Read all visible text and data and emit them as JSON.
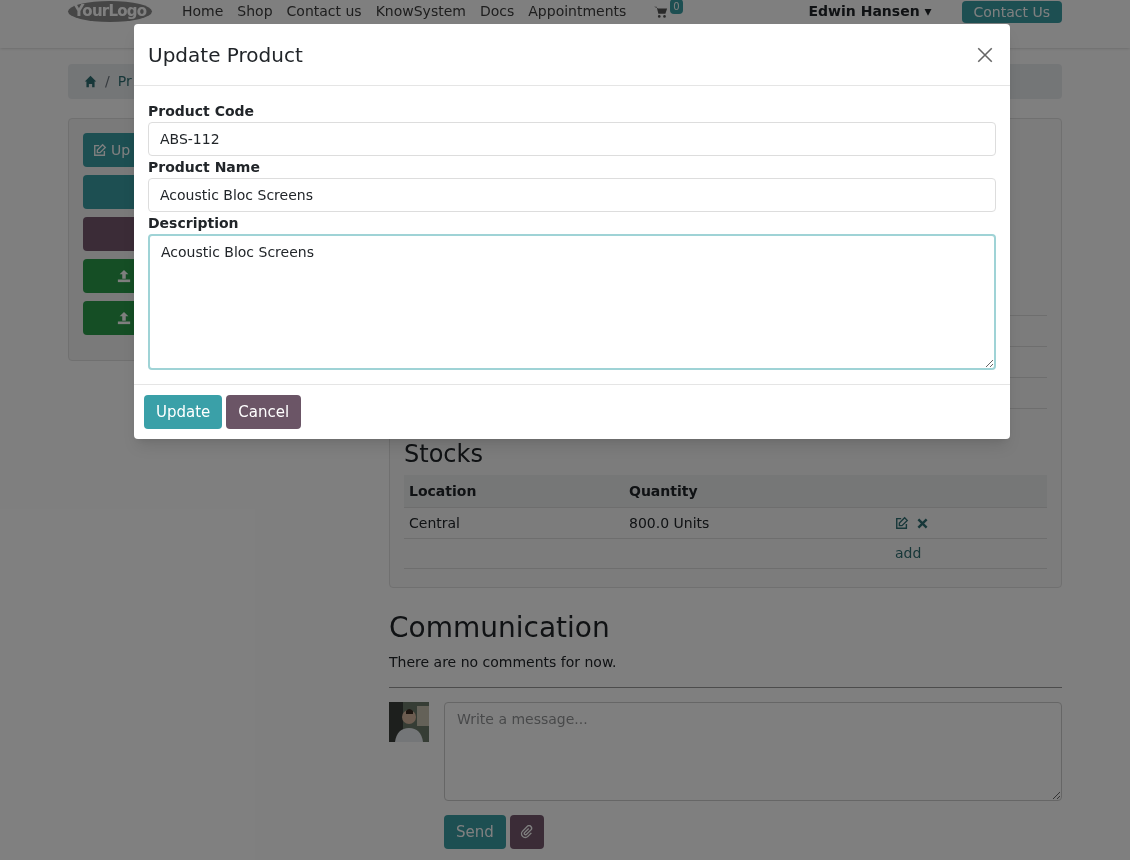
{
  "navbar": {
    "logo": "YourLogo",
    "menu": [
      "Home",
      "Shop",
      "Contact us",
      "KnowSystem",
      "Docs",
      "Appointments"
    ],
    "cart_count": "0",
    "user": "Edwin Hansen",
    "user_caret": "▾",
    "cta": "Contact Us"
  },
  "breadcrumb": {
    "separator": "/",
    "item": "Pr"
  },
  "sidebar": {
    "buttons": [
      {
        "kind": "edit",
        "label": "Up"
      },
      {
        "kind": "primary"
      },
      {
        "kind": "secondary"
      },
      {
        "kind": "upload"
      },
      {
        "kind": "upload"
      }
    ]
  },
  "stocks": {
    "title": "Stocks",
    "columns": [
      "Location",
      "Quantity"
    ],
    "rows": [
      {
        "location": "Central",
        "quantity": "800.0 Units"
      }
    ],
    "add_link": "add"
  },
  "communication": {
    "title": "Communication",
    "empty_text": "There are no comments for now.",
    "message_placeholder": "Write a message...",
    "send": "Send"
  },
  "modal": {
    "title": "Update Product",
    "fields": [
      {
        "kind": "input",
        "label": "Product Code",
        "value": "ABS-112"
      },
      {
        "kind": "input",
        "label": "Product Name",
        "value": "Acoustic Bloc Screens"
      },
      {
        "kind": "textarea",
        "label": "Description",
        "value": "Acoustic Bloc Screens",
        "focused": true
      }
    ],
    "buttons": [
      {
        "kind": "primary",
        "label": "Update"
      },
      {
        "kind": "secondary",
        "label": "Cancel"
      }
    ]
  }
}
